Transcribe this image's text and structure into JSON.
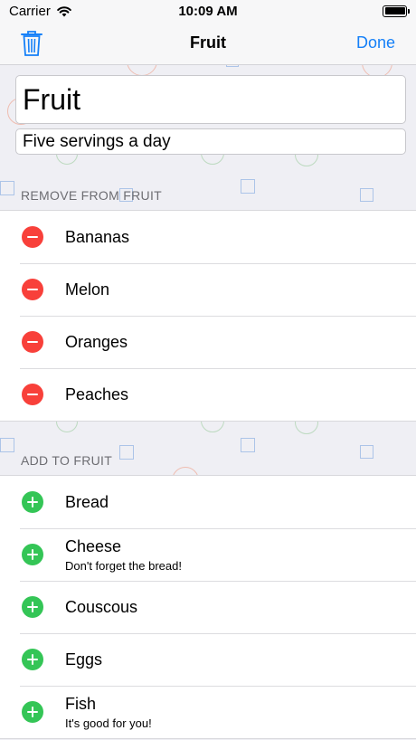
{
  "status": {
    "carrier": "Carrier",
    "time": "10:09 AM"
  },
  "nav": {
    "title": "Fruit",
    "done_label": "Done",
    "left_icon": "trash-icon",
    "accent_color": "#1580f8"
  },
  "list_editor": {
    "name_value": "Fruit",
    "description_value": "Five servings a day"
  },
  "remove_section": {
    "header": "REMOVE FROM FRUIT",
    "items": [
      {
        "label": "Bananas"
      },
      {
        "label": "Melon"
      },
      {
        "label": "Oranges"
      },
      {
        "label": "Peaches"
      }
    ]
  },
  "add_section": {
    "header": "ADD TO FRUIT",
    "items": [
      {
        "label": "Bread",
        "note": ""
      },
      {
        "label": "Cheese",
        "note": "Don't forget the bread!"
      },
      {
        "label": "Couscous",
        "note": ""
      },
      {
        "label": "Eggs",
        "note": ""
      },
      {
        "label": "Fish",
        "note": "It's good for you!"
      }
    ]
  },
  "colors": {
    "remove_badge": "#f8403a",
    "add_badge": "#34c556",
    "background": "#efeff4"
  }
}
